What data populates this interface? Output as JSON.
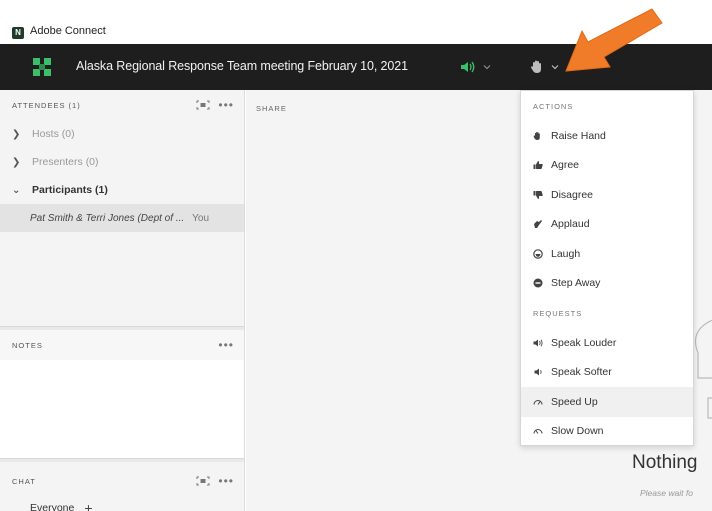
{
  "window": {
    "app_title": "Adobe Connect",
    "app_logo_letter": "N"
  },
  "meeting": {
    "title": "Alaska Regional Response Team meeting February 10, 2021",
    "audio_icon": "speaker-icon",
    "status_icon": "raise-hand-icon"
  },
  "attendees": {
    "header": "ATTENDEES (1)",
    "groups": [
      {
        "label": "Hosts (0)",
        "expanded": false
      },
      {
        "label": "Presenters (0)",
        "expanded": false
      },
      {
        "label": "Participants (1)",
        "expanded": true
      }
    ],
    "user": {
      "name": "Pat Smith & Terri Jones (Dept of ...",
      "you": "You"
    }
  },
  "notes": {
    "header": "NOTES"
  },
  "chat": {
    "header": "CHAT",
    "recipient": "Everyone"
  },
  "share": {
    "header": "SHARE",
    "empty_title": "Nothing",
    "empty_sub": "Please wait fo"
  },
  "status_menu": {
    "actions_header": "ACTIONS",
    "actions": [
      {
        "label": "Raise Hand",
        "icon": "raise-hand-icon"
      },
      {
        "label": "Agree",
        "icon": "thumbs-up-icon"
      },
      {
        "label": "Disagree",
        "icon": "thumbs-down-icon"
      },
      {
        "label": "Applaud",
        "icon": "applaud-icon"
      },
      {
        "label": "Laugh",
        "icon": "laugh-icon"
      },
      {
        "label": "Step Away",
        "icon": "step-away-icon"
      }
    ],
    "requests_header": "REQUESTS",
    "requests": [
      {
        "label": "Speak Louder",
        "icon": "speak-louder-icon"
      },
      {
        "label": "Speak Softer",
        "icon": "speak-softer-icon"
      },
      {
        "label": "Speed Up",
        "icon": "speed-up-icon",
        "highlighted": true
      },
      {
        "label": "Slow Down",
        "icon": "slow-down-icon"
      }
    ]
  },
  "colors": {
    "meeting_bar": "#1e1e1e",
    "accent_green": "#3bbf6a",
    "callout_arrow": "#f07c2a"
  }
}
